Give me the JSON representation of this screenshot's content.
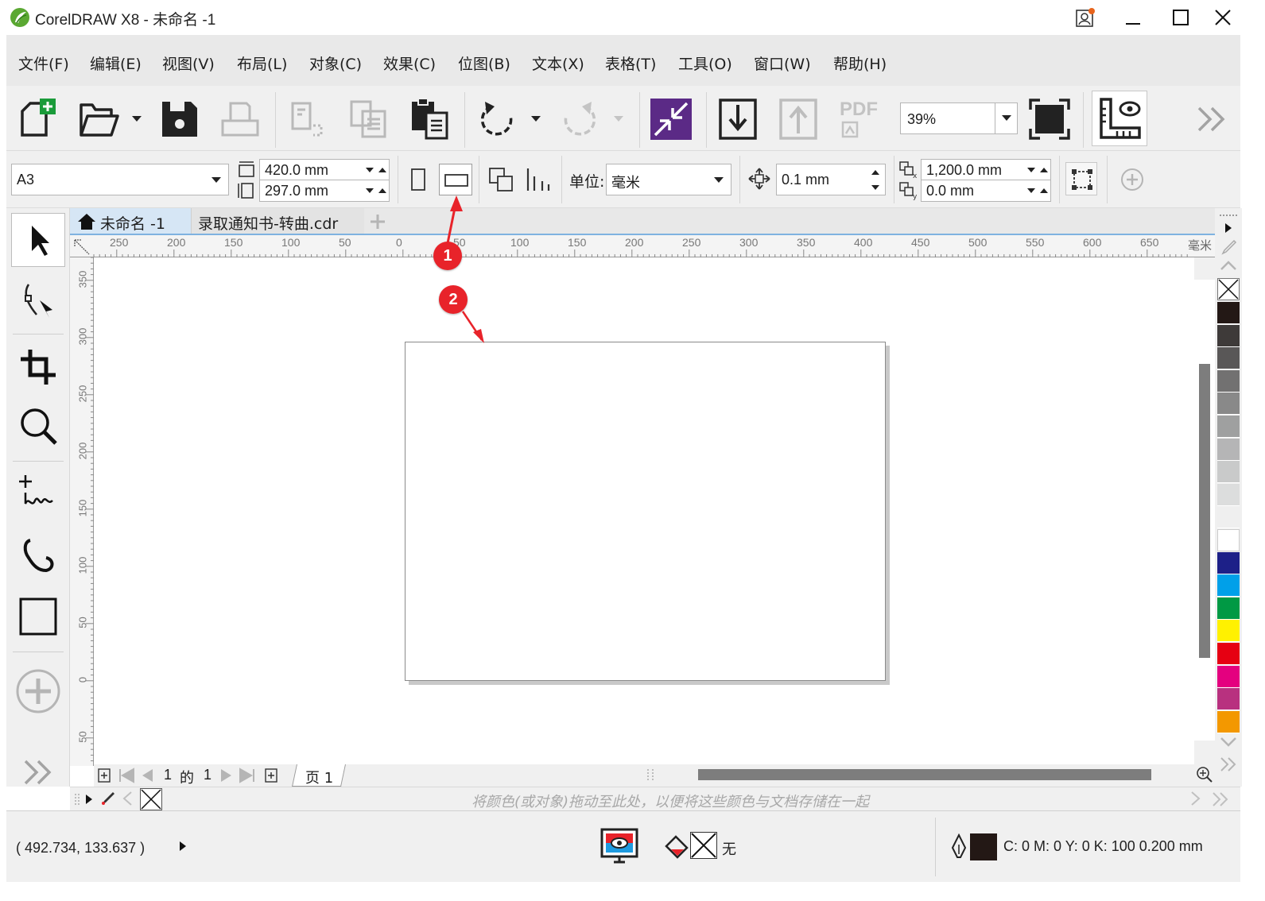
{
  "window": {
    "title": "CorelDRAW X8 - 未命名 -1"
  },
  "menu": [
    "文件(F)",
    "编辑(E)",
    "视图(V)",
    "布局(L)",
    "对象(C)",
    "效果(C)",
    "位图(B)",
    "文本(X)",
    "表格(T)",
    "工具(O)",
    "窗口(W)",
    "帮助(H)"
  ],
  "toolbar": {
    "zoom": "39%",
    "pdf_label": "PDF"
  },
  "propbar": {
    "page_size": "A3",
    "width": "420.0 mm",
    "height": "297.0 mm",
    "units_label": "单位:",
    "units": "毫米",
    "nudge": "0.1 mm",
    "dup_x": "1,200.0 mm",
    "dup_y": "0.0 mm"
  },
  "tabs": [
    {
      "label": "未命名 -1",
      "active": true
    },
    {
      "label": "录取通知书-转曲.cdr",
      "active": false
    }
  ],
  "ruler": {
    "h_ticks": [
      "250",
      "200",
      "150",
      "100",
      "50",
      "0",
      "50",
      "100",
      "150",
      "200",
      "250",
      "300",
      "350",
      "400",
      "450",
      "500",
      "550",
      "600",
      "650"
    ],
    "h_unit": "毫米",
    "v_ticks": [
      "350",
      "300",
      "250",
      "200",
      "150",
      "100",
      "50",
      "0",
      "50"
    ]
  },
  "pagenav": {
    "current": "1",
    "of_label": "的",
    "total": "1",
    "page_tab": "页 1"
  },
  "docpalette": {
    "hint": "将颜色(或对象)拖动至此处，以便将这些颜色与文档存储在一起"
  },
  "status": {
    "coords": "( 492.734, 133.637 )",
    "fill_label": "无",
    "outline_info": "C: 0 M: 0 Y: 0 K: 100  0.200 mm"
  },
  "palette": {
    "colors": [
      "#231815",
      "#3e3a39",
      "#595757",
      "#727171",
      "#898989",
      "#9fa0a0",
      "#b5b5b6",
      "#c9caca",
      "#dcdddd",
      "#efefef",
      "#ffffff",
      "#1d2088",
      "#00a0e9",
      "#009944",
      "#fff100",
      "#e60012",
      "#e4007f",
      "#b8317f",
      "#f39800"
    ]
  },
  "annotations": [
    "1",
    "2"
  ],
  "colors": {
    "accent_red": "#e8232a",
    "active_tab": "#d6e6f5"
  }
}
